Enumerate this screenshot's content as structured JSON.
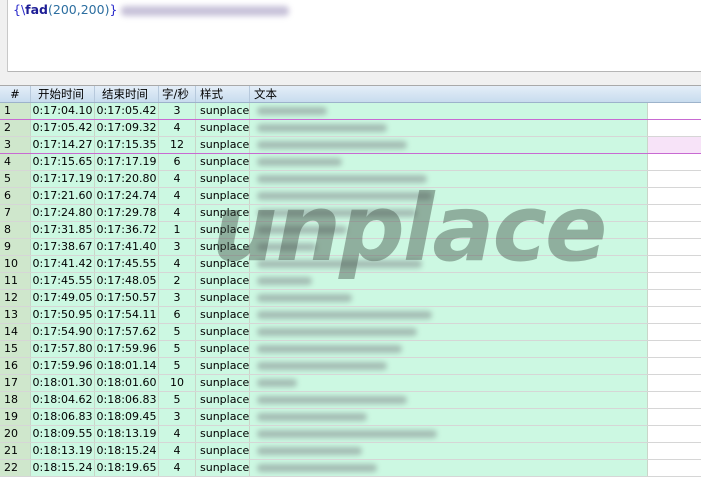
{
  "editor": {
    "brace_open": "{",
    "tag_prefix": "\\",
    "tag_name": "fad",
    "tag_args": "(200,200)",
    "brace_close": "}"
  },
  "grid": {
    "columns": [
      "#",
      "开始时间",
      "结束时间",
      "字/秒",
      "样式",
      "文本"
    ],
    "rows": [
      {
        "n": "1",
        "start": "0:17:04.10",
        "end": "0:17:05.42",
        "cps": "3",
        "style": "sunplace"
      },
      {
        "n": "2",
        "start": "0:17:05.42",
        "end": "0:17:09.32",
        "cps": "4",
        "style": "sunplace"
      },
      {
        "n": "3",
        "start": "0:17:14.27",
        "end": "0:17:15.35",
        "cps": "12",
        "style": "sunplace"
      },
      {
        "n": "4",
        "start": "0:17:15.65",
        "end": "0:17:17.19",
        "cps": "6",
        "style": "sunplace"
      },
      {
        "n": "5",
        "start": "0:17:17.19",
        "end": "0:17:20.80",
        "cps": "4",
        "style": "sunplace"
      },
      {
        "n": "6",
        "start": "0:17:21.60",
        "end": "0:17:24.74",
        "cps": "4",
        "style": "sunplace"
      },
      {
        "n": "7",
        "start": "0:17:24.80",
        "end": "0:17:29.78",
        "cps": "4",
        "style": "sunplace"
      },
      {
        "n": "8",
        "start": "0:17:31.85",
        "end": "0:17:36.72",
        "cps": "1",
        "style": "sunplace"
      },
      {
        "n": "9",
        "start": "0:17:38.67",
        "end": "0:17:41.40",
        "cps": "3",
        "style": "sunplace"
      },
      {
        "n": "10",
        "start": "0:17:41.42",
        "end": "0:17:45.55",
        "cps": "4",
        "style": "sunplace"
      },
      {
        "n": "11",
        "start": "0:17:45.55",
        "end": "0:17:48.05",
        "cps": "2",
        "style": "sunplace"
      },
      {
        "n": "12",
        "start": "0:17:49.05",
        "end": "0:17:50.57",
        "cps": "3",
        "style": "sunplace"
      },
      {
        "n": "13",
        "start": "0:17:50.95",
        "end": "0:17:54.11",
        "cps": "6",
        "style": "sunplace"
      },
      {
        "n": "14",
        "start": "0:17:54.90",
        "end": "0:17:57.62",
        "cps": "5",
        "style": "sunplace"
      },
      {
        "n": "15",
        "start": "0:17:57.80",
        "end": "0:17:59.96",
        "cps": "5",
        "style": "sunplace"
      },
      {
        "n": "16",
        "start": "0:17:59.96",
        "end": "0:18:01.14",
        "cps": "5",
        "style": "sunplace"
      },
      {
        "n": "17",
        "start": "0:18:01.30",
        "end": "0:18:01.60",
        "cps": "10",
        "style": "sunplace"
      },
      {
        "n": "18",
        "start": "0:18:04.62",
        "end": "0:18:06.83",
        "cps": "5",
        "style": "sunplace"
      },
      {
        "n": "19",
        "start": "0:18:06.83",
        "end": "0:18:09.45",
        "cps": "3",
        "style": "sunplace"
      },
      {
        "n": "20",
        "start": "0:18:09.55",
        "end": "0:18:13.19",
        "cps": "4",
        "style": "sunplace"
      },
      {
        "n": "21",
        "start": "0:18:13.19",
        "end": "0:18:15.24",
        "cps": "4",
        "style": "sunplace"
      },
      {
        "n": "22",
        "start": "0:18:15.24",
        "end": "0:18:19.65",
        "cps": "4",
        "style": "sunplace"
      }
    ]
  },
  "watermark": "unplace",
  "colors": {
    "row_bg": "#ccf8e2",
    "number_bg": "#cfe7cc",
    "header_bg": "#c8dcee",
    "selected_row_border": "#c86ad2"
  }
}
